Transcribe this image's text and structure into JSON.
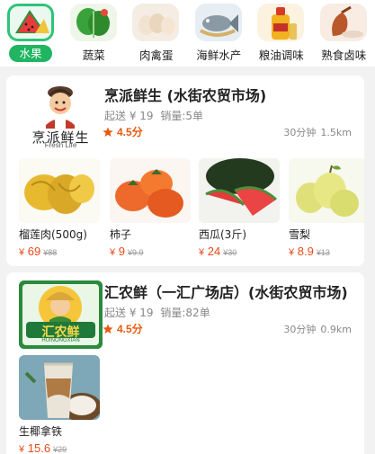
{
  "categories": [
    {
      "label": "水果",
      "icon": "watermelon-icon",
      "active": true
    },
    {
      "label": "蔬菜",
      "icon": "vegetable-icon",
      "active": false
    },
    {
      "label": "肉禽蛋",
      "icon": "egg-icon",
      "active": false
    },
    {
      "label": "海鲜水产",
      "icon": "fish-icon",
      "active": false
    },
    {
      "label": "粮油调味",
      "icon": "oil-bottle-icon",
      "active": false
    },
    {
      "label": "熟食卤味",
      "icon": "roast-duck-icon",
      "active": false
    }
  ],
  "shops": [
    {
      "name": "烹派鲜生 (水街农贸市场)",
      "logo_text": "烹派鲜生",
      "logo_sub": "Fresh Life",
      "delivery_min": "起送 ¥ 19",
      "sales": "销量:5单",
      "rating": "4.5分",
      "delivery_time": "30分钟",
      "distance": "1.5km",
      "products": [
        {
          "name": "榴莲肉(500g)",
          "price": "69",
          "original": "¥88",
          "icon": "durian-icon"
        },
        {
          "name": "柿子",
          "price": "9",
          "original": "¥9.9",
          "icon": "persimmon-icon"
        },
        {
          "name": "西瓜(3斤)",
          "price": "24",
          "original": "¥30",
          "icon": "watermelon-slice-icon"
        },
        {
          "name": "雪梨",
          "price": "8.9",
          "original": "¥13",
          "icon": "pear-icon"
        }
      ]
    },
    {
      "name": "汇农鲜（一汇广场店）(水街农贸市场)",
      "logo_text": "汇农鲜",
      "logo_sub": "HUINONGXIAN",
      "delivery_min": "起送 ¥ 19",
      "sales": "销量:82单",
      "rating": "4.5分",
      "delivery_time": "30分钟",
      "distance": "0.9km",
      "products": [
        {
          "name": "生椰拿铁",
          "price": "15.6",
          "original": "¥29",
          "icon": "coconut-latte-icon"
        }
      ]
    }
  ],
  "currency": "¥",
  "colors": {
    "accent": "#1fb561",
    "price": "#e84a1a",
    "rating": "#e85a10"
  }
}
